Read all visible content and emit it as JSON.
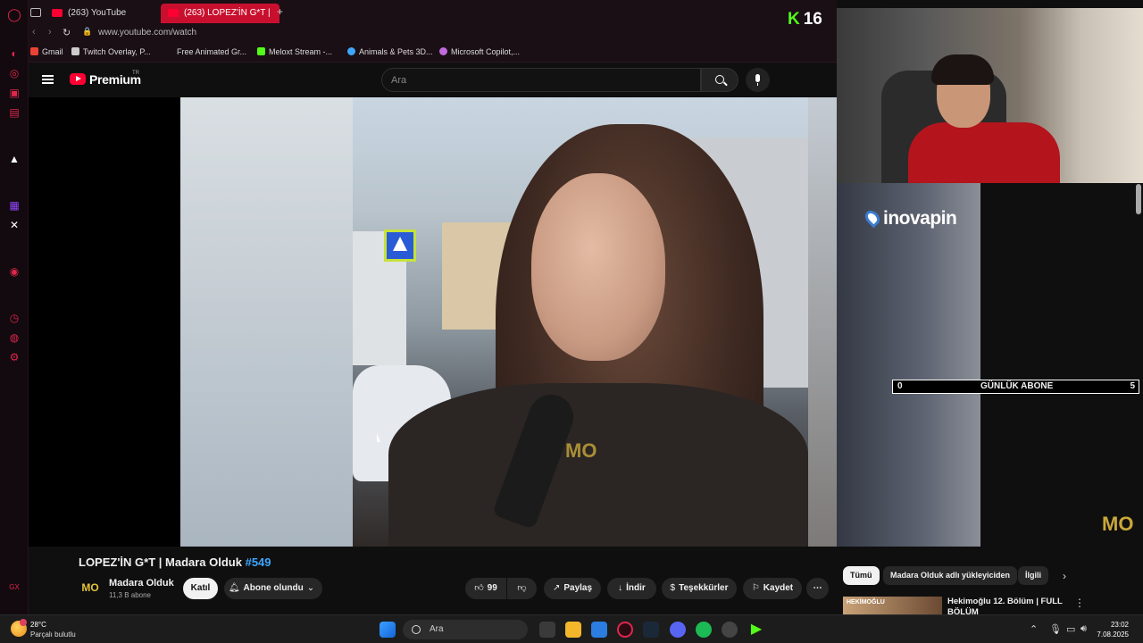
{
  "browser": {
    "tabs": [
      {
        "label": "(263) YouTube",
        "active": false
      },
      {
        "label": "(263) LOPEZ'İN G*T |",
        "active": true
      }
    ],
    "new_tab_label": "+",
    "url": "www.youtube.com/watch",
    "bookmarks": [
      {
        "label": "Gmail",
        "icon": "gmail-icon",
        "color": "#ea4335"
      },
      {
        "label": "Twitch Overlay, P...",
        "icon": "document-icon",
        "color": "#cccccc"
      },
      {
        "label": "Free Animated Gr...",
        "icon": "",
        "color": ""
      },
      {
        "label": "Meloxt Stream -...",
        "icon": "kick-icon",
        "color": "#53fc18"
      },
      {
        "label": "Animals & Pets 3D...",
        "icon": "globe-icon",
        "color": "#3ea6ff"
      },
      {
        "label": "Microsoft Copilot,...",
        "icon": "copilot-icon",
        "color": "#c26adf"
      }
    ]
  },
  "youtube": {
    "brand": "Premium",
    "region": "TR",
    "search_placeholder": "Ara",
    "video": {
      "title_main": "LOPEZ'İN G*T | Madara Olduk ",
      "title_hashtag": "#549",
      "watermark": "MO"
    },
    "channel": {
      "logo_text": "MO",
      "name": "Madara Olduk",
      "subscribers": "11,3 B abone"
    },
    "actions": {
      "join": "Katıl",
      "subscribed": "Abone olundu",
      "like_count": "99",
      "share": "Paylaş",
      "download": "İndir",
      "thanks": "Teşekkürler",
      "save": "Kaydet",
      "more": "⋯"
    },
    "chips": [
      "Tümü",
      "Madara Olduk adlı yükleyiciden",
      "İlgili"
    ],
    "recommendation": {
      "thumb_text": "HEKİMOĞLU",
      "title": "Hekimoğlu 12. Bölüm | FULL BÖLÜM"
    }
  },
  "stream_overlay": {
    "kick_label": "K",
    "kick_viewers": "16",
    "sponsor": "inovapin",
    "sub_goal": {
      "current": "0",
      "label": "GÜNLÜK ABONE",
      "target": "5"
    },
    "corner_logo": "MO"
  },
  "taskbar": {
    "temperature": "28°C",
    "condition": "Parçalı bulutlu",
    "search_label": "Ara",
    "time": "23:02",
    "date": "7.08.2025"
  },
  "colors": {
    "accent_red": "#c8102e",
    "youtube_red": "#ff0033",
    "kick_green": "#53fc18",
    "hashtag_blue": "#3ea6ff"
  }
}
